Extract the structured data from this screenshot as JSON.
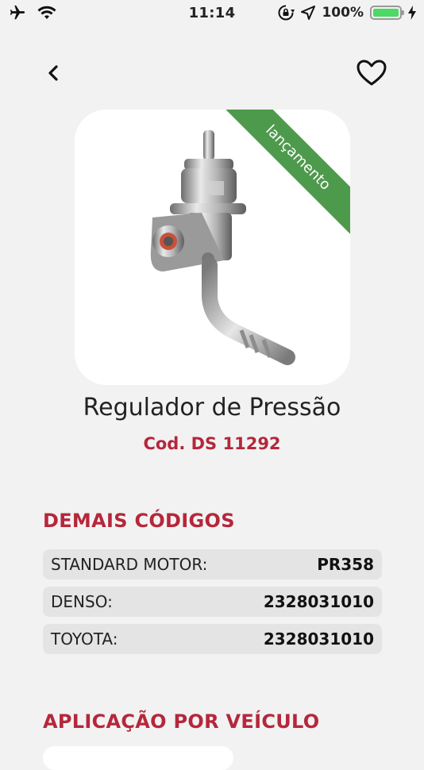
{
  "status_bar": {
    "time": "11:14",
    "battery_text": "100%",
    "battery_level": 1.0,
    "icons": [
      "airplane-icon",
      "wifi-icon",
      "rotation-lock-icon",
      "location-icon",
      "battery-icon",
      "charging-icon"
    ]
  },
  "nav": {
    "back_icon": "chevron-left-icon",
    "favorite_icon": "heart-outline-icon"
  },
  "product": {
    "badge": "lançamento",
    "badge_color": "#4e9a4d",
    "title": "Regulador de Pressão",
    "code": "Cod. DS 11292",
    "accent_color": "#b5273b"
  },
  "other_codes": {
    "title": "DEMAIS CÓDIGOS",
    "rows": [
      {
        "label": "STANDARD MOTOR:",
        "value": "PR358"
      },
      {
        "label": "DENSO:",
        "value": "2328031010"
      },
      {
        "label": "TOYOTA:",
        "value": "2328031010"
      }
    ]
  },
  "vehicle_application": {
    "title": "APLICAÇÃO POR VEÍCULO"
  }
}
